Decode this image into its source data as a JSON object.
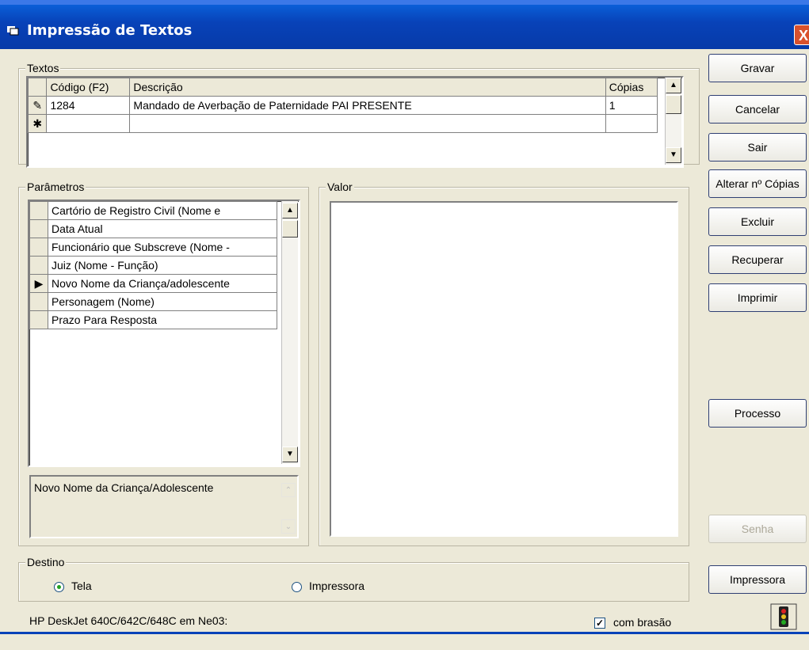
{
  "window": {
    "title": "Impressão de Textos",
    "close": "X"
  },
  "textos": {
    "legend": "Textos",
    "columns": [
      "Código (F2)",
      "Descrição",
      "Cópias"
    ],
    "rows": [
      {
        "marker": "✎",
        "codigo": "1284",
        "descricao": "Mandado de Averbação de Paternidade PAI PRESENTE",
        "copias": "1"
      },
      {
        "marker": "✱",
        "codigo": "",
        "descricao": "",
        "copias": ""
      }
    ]
  },
  "parametros": {
    "legend": "Parâmetros",
    "items": [
      "Cartório de Registro Civil (Nome e",
      "Data Atual",
      "Funcionário que Subscreve (Nome -",
      "Juiz (Nome - Função)",
      "Novo Nome da Criança/adolescente",
      "Personagem (Nome)",
      "Prazo Para Resposta"
    ],
    "selected_index": 4,
    "description": "Novo Nome da Criança/Adolescente"
  },
  "valor": {
    "legend": "Valor",
    "value": ""
  },
  "destino": {
    "legend": "Destino",
    "options": [
      "Tela",
      "Impressora"
    ],
    "selected": "Tela"
  },
  "printer_label": "HP DeskJet 640C/642C/648C em Ne03:",
  "com_brasao": {
    "label": "com brasão",
    "checked": true
  },
  "buttons": {
    "gravar": "Gravar",
    "cancelar": "Cancelar",
    "sair": "Sair",
    "alterar_copias": "Alterar nº Cópias",
    "excluir": "Excluir",
    "recuperar": "Recuperar",
    "imprimir": "Imprimir",
    "processo": "Processo",
    "senha": "Senha",
    "impressora": "Impressora"
  }
}
